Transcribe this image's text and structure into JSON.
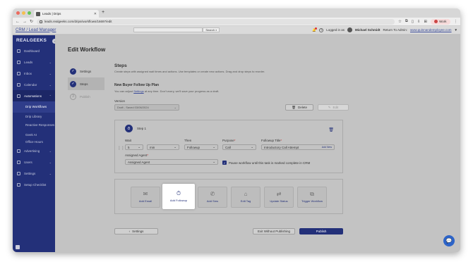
{
  "browser": {
    "tab_title": "Leads | Drips",
    "new_tab": "+",
    "url": "leads.realgeeks.com/drips/workflows/16697/edit",
    "profile_label": "Work",
    "traffic_lights": [
      "#ec6a5e",
      "#f4bf4f",
      "#61c554"
    ]
  },
  "header": {
    "crm_link": "CRM / Lead Manager",
    "search_placeholder": "",
    "search_button": "Search",
    "logged_in_as": "Logged in as",
    "user_name": "Michael Schmidt",
    "return_label": "Return To Admin:",
    "site_link": "www.quinnandemployee.com"
  },
  "sidebar": {
    "logo": "REALGEEKS",
    "items": [
      {
        "label": "Dashboard",
        "icon": "dashboard-icon"
      },
      {
        "label": "Leads",
        "icon": "leads-icon"
      },
      {
        "label": "Inbox",
        "icon": "inbox-icon"
      },
      {
        "label": "Calendar",
        "icon": "calendar-icon"
      },
      {
        "label": "Automations",
        "icon": "automations-icon"
      }
    ],
    "sub_items": [
      "Drip Workflows",
      "Drip Library",
      "Reactive Responses",
      "Geek AI",
      "Office Hours"
    ],
    "items_after": [
      {
        "label": "Advertising",
        "icon": "advertising-icon"
      },
      {
        "label": "Users",
        "icon": "users-icon"
      },
      {
        "label": "Settings",
        "icon": "settings-icon"
      },
      {
        "label": "Setup Checklist",
        "icon": "checklist-icon"
      }
    ]
  },
  "page": {
    "title": "Edit Workflow",
    "steps_nav": [
      {
        "label": "Settings",
        "state": "done"
      },
      {
        "label": "Steps",
        "state": "active"
      },
      {
        "label": "Publish",
        "state": "pending",
        "number": "3"
      }
    ]
  },
  "steps_section": {
    "heading": "Steps",
    "subheading": "Create steps with assigned wait times and actions. Use templates or create new actions. Drag and drop steps to reorder.",
    "plan_title": "New Buyer Follow Up Plan",
    "plan_desc_prefix": "You can adjust",
    "plan_desc_link": "Settings",
    "plan_desc_suffix": "at any time. Don't worry, we'll save your progress as a draft.",
    "version_label": "Version",
    "version_value": "Draft - Saved 03/06/2024",
    "delete_button": "Delete",
    "edit_button": "Edit"
  },
  "step": {
    "title": "Step 1",
    "wait_label": "Wait",
    "wait_value": "5",
    "wait_unit": "min",
    "then_label": "Then",
    "then_value": "Followup",
    "purpose_label": "Purpose",
    "purpose_value": "Call",
    "followup_title_label": "Followup Title",
    "followup_title_value": "Introductory Call Attempt",
    "add_new": "Add New",
    "assigned_agent_label": "Assigned Agent",
    "assigned_agent_value": "Assigned Agent",
    "pause_label": "Pause workflow until this task is marked complete in CRM"
  },
  "actions": [
    {
      "label": "Add Email",
      "icon": "email-icon",
      "glyph": "✉"
    },
    {
      "label": "Add Followup",
      "icon": "stopwatch-icon",
      "glyph": "⏱"
    },
    {
      "label": "Add Sms",
      "icon": "sms-icon",
      "glyph": "✆"
    },
    {
      "label": "Edit Tag",
      "icon": "tag-icon",
      "glyph": "⌂"
    },
    {
      "label": "Update Status",
      "icon": "status-icon",
      "glyph": "⇄"
    },
    {
      "label": "Trigger Workflow",
      "icon": "workflow-icon",
      "glyph": "⧉"
    }
  ],
  "footer": {
    "back_button": "Settings",
    "exit_button": "Exit Without Publishing",
    "publish_button": "Publish"
  },
  "colors": {
    "brand_navy": "#233079",
    "link_blue": "#3a4b99",
    "chat_blue": "#2d64c8"
  }
}
